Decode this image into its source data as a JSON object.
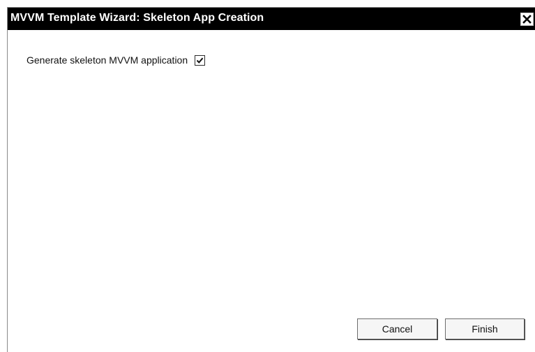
{
  "window": {
    "title": "MVVM Template Wizard: Skeleton App Creation",
    "close_icon": "close-icon"
  },
  "options": {
    "generate_skeleton": {
      "label": "Generate skeleton MVVM application",
      "checked": true
    }
  },
  "buttons": {
    "cancel_label": "Cancel",
    "finish_label": "Finish"
  },
  "colors": {
    "titlebar_bg": "#000000",
    "titlebar_text": "#ffffff",
    "window_bg": "#ffffff"
  }
}
